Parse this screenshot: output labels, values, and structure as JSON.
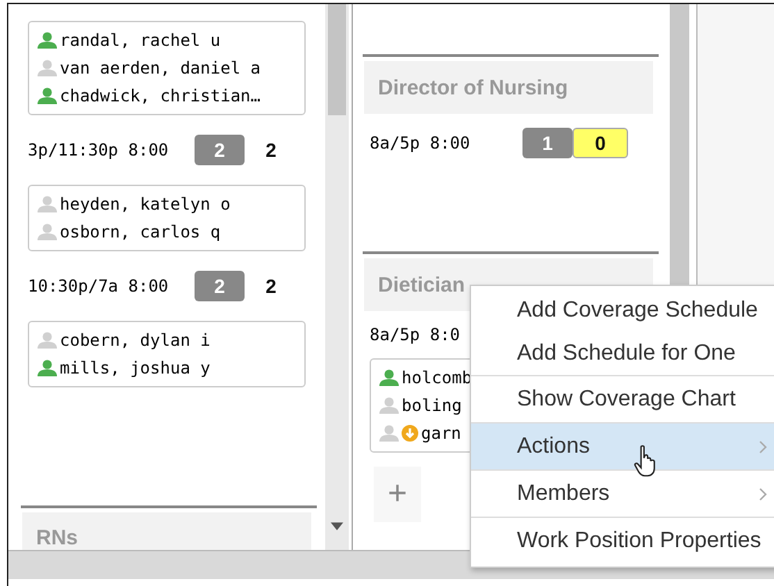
{
  "left_column": {
    "cards": [
      {
        "people": [
          {
            "name": "randal, rachel u",
            "active": true
          },
          {
            "name": "van aerden, daniel a",
            "active": false
          },
          {
            "name": "chadwick, christian…",
            "active": true
          }
        ]
      },
      {
        "shift": {
          "time": "3p/11:30p 8:00",
          "required": "2",
          "filled": "2",
          "kind": "plain"
        },
        "people": [
          {
            "name": "heyden, katelyn o",
            "active": false
          },
          {
            "name": "osborn, carlos q",
            "active": false
          }
        ]
      },
      {
        "shift": {
          "time": "10:30p/7a 8:00",
          "required": "2",
          "filled": "2",
          "kind": "plain"
        },
        "people": [
          {
            "name": "cobern, dylan i",
            "active": false
          },
          {
            "name": "mills, joshua y",
            "active": true
          }
        ]
      }
    ],
    "next_section": "RNs"
  },
  "middle_column": {
    "sections": [
      {
        "title": "Director of Nursing",
        "shift": {
          "time": "8a/5p 8:00",
          "required": "1",
          "filled": "0",
          "kind": "warning"
        }
      },
      {
        "title": "Dietician",
        "shift": {
          "time": "8a/5p 8:0"
        },
        "people": [
          {
            "name": "holcomb",
            "active": true,
            "alert": false
          },
          {
            "name": "boling",
            "active": false,
            "alert": false
          },
          {
            "name": "garn",
            "active": false,
            "alert": true
          }
        ]
      }
    ],
    "add_button": "+"
  },
  "context_menu": {
    "items": [
      {
        "label": "Add Coverage Schedule",
        "submenu": false,
        "selected": false,
        "divider_before": false
      },
      {
        "label": "Add Schedule for One",
        "submenu": false,
        "selected": false,
        "divider_before": false
      },
      {
        "label": "Show Coverage Chart",
        "submenu": false,
        "selected": false,
        "divider_before": true
      },
      {
        "label": "Actions",
        "submenu": true,
        "selected": true,
        "divider_before": true
      },
      {
        "label": "Members",
        "submenu": true,
        "selected": false,
        "divider_before": true
      },
      {
        "label": "Work Position Properties",
        "submenu": false,
        "selected": false,
        "divider_before": true
      }
    ]
  }
}
